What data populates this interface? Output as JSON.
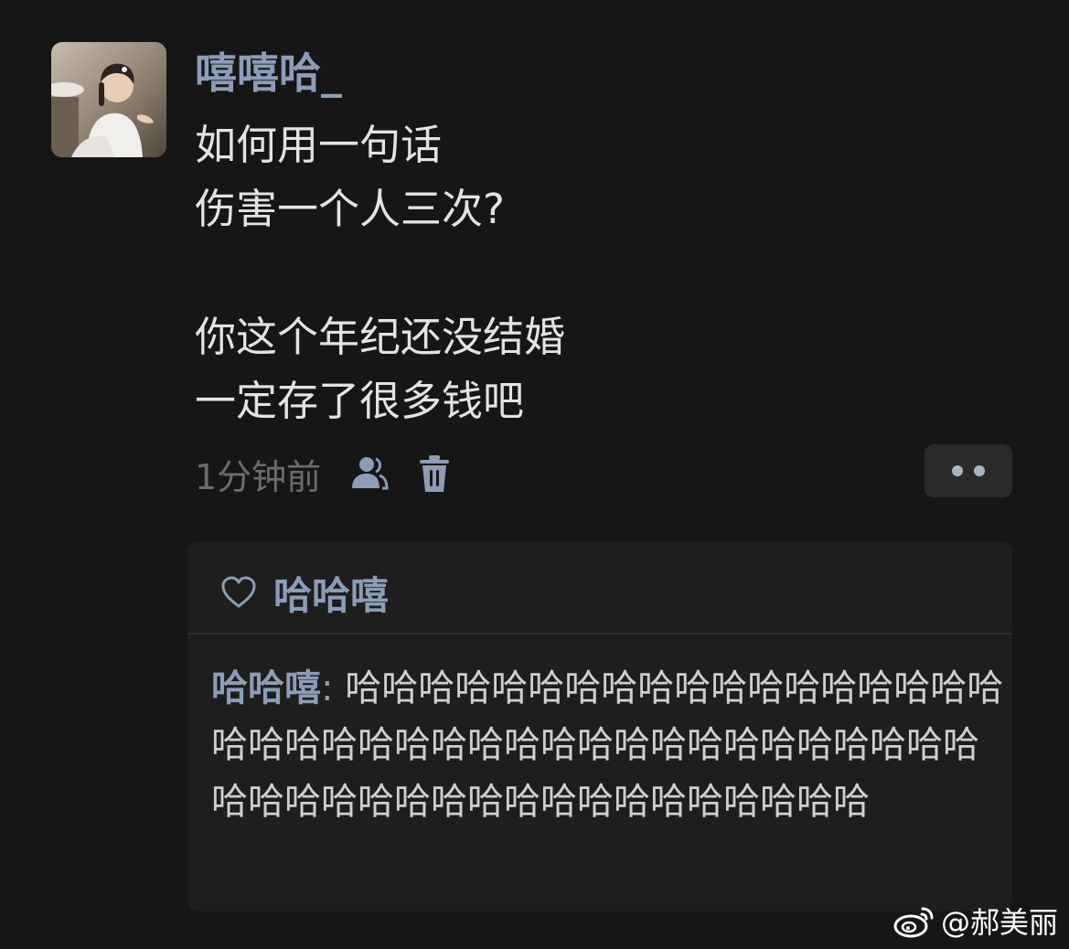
{
  "post": {
    "username": "嘻嘻哈_",
    "lines": [
      "如何用一句话",
      "伤害一个人三次?",
      "",
      "你这个年纪还没结婚",
      "一定存了很多钱吧"
    ],
    "timestamp": "1分钟前"
  },
  "reply": {
    "liked_by": "哈哈嘻",
    "comment_author": "哈哈嘻",
    "comment_separator": ": ",
    "comment_text": "哈哈哈哈哈哈哈哈哈哈哈哈哈哈哈哈哈哈哈哈哈哈哈哈哈哈哈哈哈哈哈哈哈哈哈哈哈哈哈哈哈哈哈哈哈哈哈哈哈哈哈哈哈哈哈哈哈"
  },
  "watermark": {
    "text": "@郝美丽"
  },
  "icons": {
    "friends": "people-icon",
    "delete": "trash-icon",
    "more": "more-dots-icon",
    "like": "heart-icon",
    "watermark_logo": "weibo-logo-icon"
  },
  "colors": {
    "background": "#161616",
    "username": "#8d9db6",
    "text": "#e3e3e3",
    "muted": "#6c6c6c",
    "card": "#1e1e1e"
  }
}
